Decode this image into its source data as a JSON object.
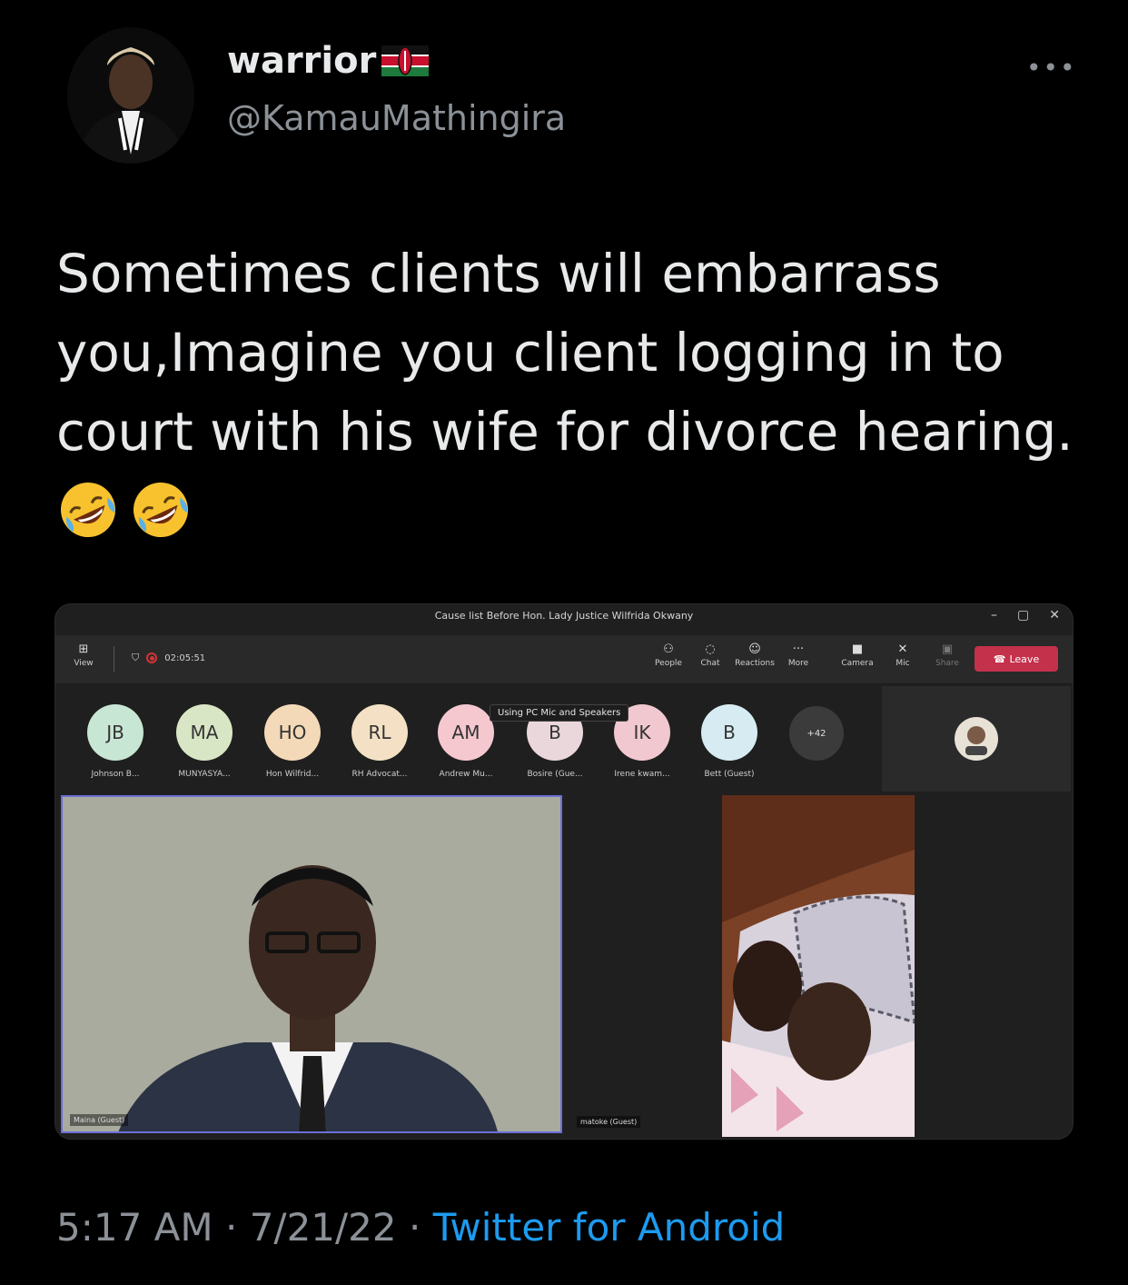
{
  "tweet": {
    "display_name": "warrior",
    "handle": "@KamauMathingira",
    "more_label": "•••",
    "text": "Sometimes clients will embarrass you,Imagine you client logging in to court with his wife for divorce hearing.",
    "emojis": [
      "rolling-on-floor-laughing-emoji",
      "rolling-on-floor-laughing-emoji"
    ],
    "time": "5:17 AM",
    "date": "7/21/22",
    "source": "Twitter for Android"
  },
  "teams": {
    "window_title": "Cause list Before Hon. Lady Justice Wilfrida Okwany",
    "window_controls": [
      "–",
      "▢",
      "✕"
    ],
    "view_label": "View",
    "timer": "02:05:51",
    "toolbar": [
      {
        "label": "People",
        "icon": "people-icon"
      },
      {
        "label": "Chat",
        "icon": "chat-icon"
      },
      {
        "label": "Reactions",
        "icon": "reactions-icon"
      },
      {
        "label": "More",
        "icon": "more-icon"
      },
      {
        "label": "Camera",
        "icon": "camera-off-icon"
      },
      {
        "label": "Mic",
        "icon": "mic-off-icon"
      },
      {
        "label": "Share",
        "icon": "share-icon"
      }
    ],
    "leave_label": "Leave",
    "tooltip": "Using PC Mic and Speakers",
    "participants": [
      {
        "initials": "JB",
        "name": "Johnson B...",
        "color": "#c7e6d4"
      },
      {
        "initials": "MA",
        "name": "MUNYASYA...",
        "color": "#d9e6c5"
      },
      {
        "initials": "HO",
        "name": "Hon Wilfrid...",
        "color": "#f3d9b8"
      },
      {
        "initials": "RL",
        "name": "RH Advocat...",
        "color": "#f4e1c5"
      },
      {
        "initials": "AM",
        "name": "Andrew Mu...",
        "color": "#f5c7cf"
      },
      {
        "initials": "B",
        "name": "Bosire (Gue...",
        "color": "#ead7dc"
      },
      {
        "initials": "IK",
        "name": "Irene kwam...",
        "color": "#f1c8cf"
      },
      {
        "initials": "B",
        "name": "Bett (Guest)",
        "color": "#d7ecf2"
      }
    ],
    "more_participants": "+42",
    "video_main_label": "Maina (Guest)",
    "video_mid_label": "matoke (Guest)"
  }
}
